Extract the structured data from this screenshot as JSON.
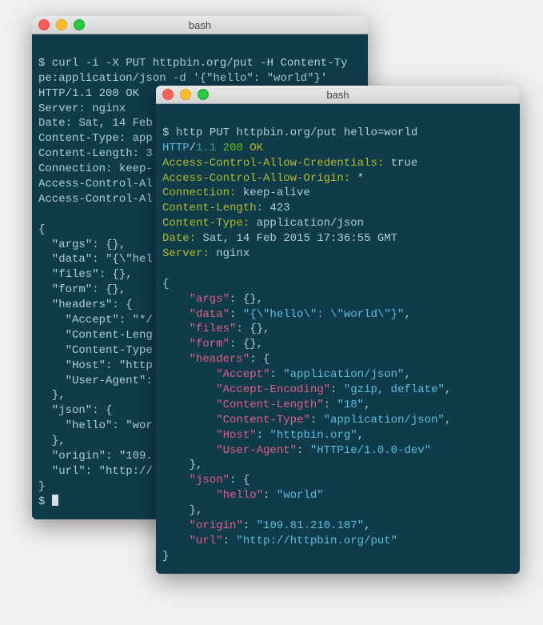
{
  "window1": {
    "title": "bash",
    "prompt1": "$ ",
    "cmd_line1": "curl -i -X PUT httpbin.org/put -H Content-Ty",
    "cmd_line2": "pe:application/json -d '{\"hello\": \"world\"}'",
    "resp_protocol": "HTTP/1.1 200 OK",
    "resp_headers": {
      "server": "Server: nginx",
      "date": "Date: Sat, 14 Feb",
      "ctype": "Content-Type: app",
      "clen": "Content-Length: 3",
      "conn": "Connection: keep-",
      "acao": "Access-Control-Al",
      "acac": "Access-Control-Al"
    },
    "json": {
      "brace_o": "{",
      "args": "  \"args\": {},",
      "data": "  \"data\": \"{\\\"hel",
      "files": "  \"files\": {},",
      "form": "  \"form\": {},",
      "headers": "  \"headers\": {",
      "accept": "    \"Accept\": \"*/",
      "clen": "    \"Content-Leng",
      "ctype": "    \"Content-Type",
      "host": "    \"Host\": \"http",
      "ua": "    \"User-Agent\":",
      "close1": "  },",
      "json": "  \"json\": {",
      "hello": "    \"hello\": \"wor",
      "close2": "  },",
      "origin": "  \"origin\": \"109.",
      "url": "  \"url\": \"http://",
      "brace_c": "}",
      "prompt2": "$ "
    }
  },
  "window2": {
    "title": "bash",
    "prompt": "$ ",
    "cmd": "http PUT httpbin.org/put hello=world",
    "resp": {
      "protocol": "HTTP",
      "slash": "/",
      "version": "1.1",
      "sp": " ",
      "status": "200",
      "reason": "OK",
      "h_acac_k": "Access-Control-Allow-Credentials:",
      "h_acac_v": " true",
      "h_acao_k": "Access-Control-Allow-Origin:",
      "h_acao_v": " *",
      "h_conn_k": "Connection:",
      "h_conn_v": " keep-alive",
      "h_clen_k": "Content-Length:",
      "h_clen_v": " 423",
      "h_ctype_k": "Content-Type:",
      "h_ctype_v": " application/json",
      "h_date_k": "Date:",
      "h_date_v": " Sat, 14 Feb 2015 17:36:55 GMT",
      "h_server_k": "Server:",
      "h_server_v": " nginx"
    },
    "body": {
      "b0": "{",
      "b1a": "    \"args\"",
      "b1b": ": {},",
      "b2a": "    \"data\"",
      "b2b": ": ",
      "b2c": "\"{\\\"hello\\\": \\\"world\\\"}\"",
      "b2d": ",",
      "b3a": "    \"files\"",
      "b3b": ": {},",
      "b4a": "    \"form\"",
      "b4b": ": {},",
      "b5a": "    \"headers\"",
      "b5b": ": {",
      "b6a": "        \"Accept\"",
      "b6b": ": ",
      "b6c": "\"application/json\"",
      "b6d": ",",
      "b7a": "        \"Accept-Encoding\"",
      "b7b": ": ",
      "b7c": "\"gzip, deflate\"",
      "b7d": ",",
      "b8a": "        \"Content-Length\"",
      "b8b": ": ",
      "b8c": "\"18\"",
      "b8d": ",",
      "b9a": "        \"Content-Type\"",
      "b9b": ": ",
      "b9c": "\"application/json\"",
      "b9d": ",",
      "b10a": "        \"Host\"",
      "b10b": ": ",
      "b10c": "\"httpbin.org\"",
      "b10d": ",",
      "b11a": "        \"User-Agent\"",
      "b11b": ": ",
      "b11c": "\"HTTPie/1.0.0-dev\"",
      "b12": "    },",
      "b13a": "    \"json\"",
      "b13b": ": {",
      "b14a": "        \"hello\"",
      "b14b": ": ",
      "b14c": "\"world\"",
      "b15": "    },",
      "b16a": "    \"origin\"",
      "b16b": ": ",
      "b16c": "\"109.81.210.187\"",
      "b16d": ",",
      "b17a": "    \"url\"",
      "b17b": ": ",
      "b17c": "\"http://httpbin.org/put\"",
      "b18": "}"
    }
  }
}
